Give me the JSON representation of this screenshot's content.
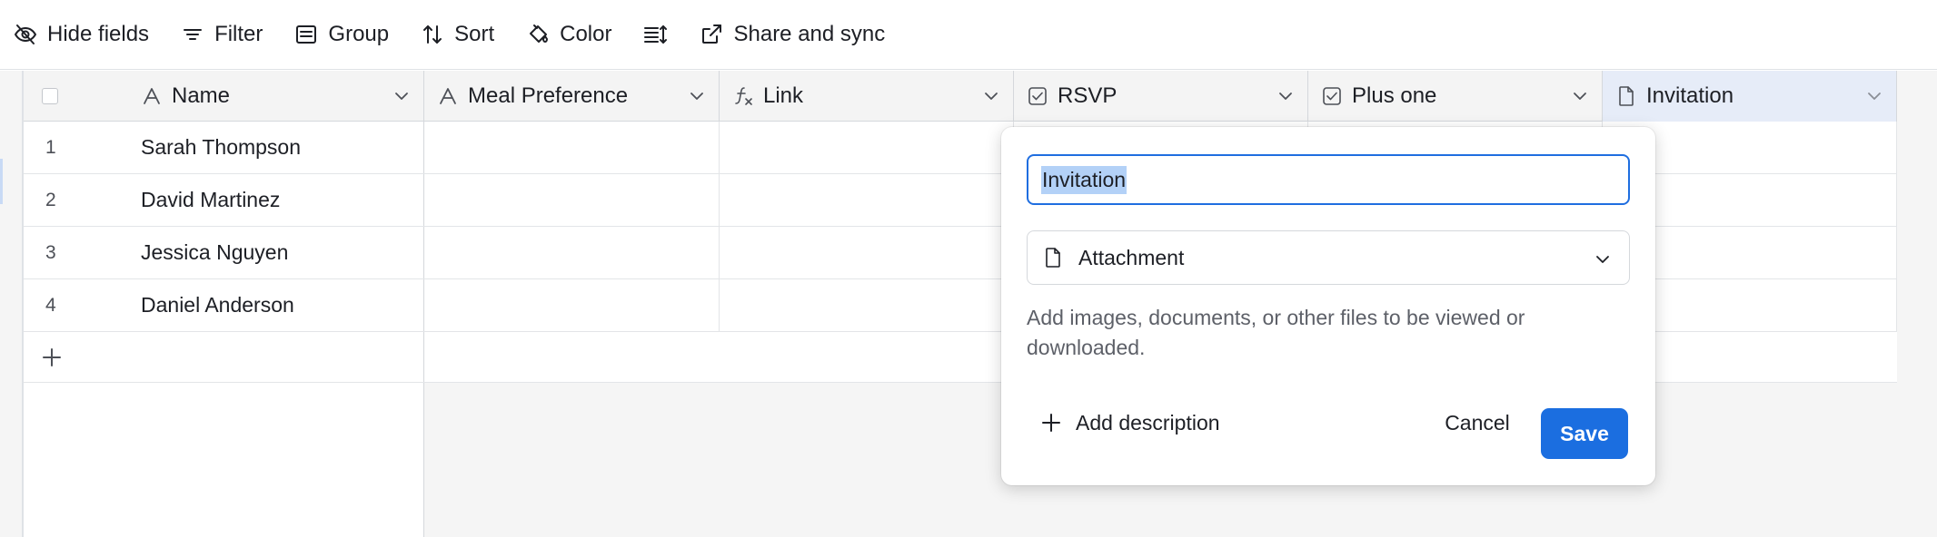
{
  "toolbar": {
    "hide_fields": "Hide fields",
    "filter": "Filter",
    "group": "Group",
    "sort": "Sort",
    "color": "Color",
    "share_sync": "Share and sync"
  },
  "columns": [
    {
      "label": "Name",
      "icon": "text-a-icon"
    },
    {
      "label": "Meal Preference",
      "icon": "text-a-icon"
    },
    {
      "label": "Link",
      "icon": "formula-icon"
    },
    {
      "label": "RSVP",
      "icon": "checkbox-icon"
    },
    {
      "label": "Plus one",
      "icon": "checkbox-icon"
    },
    {
      "label": "Invitation",
      "icon": "document-icon"
    }
  ],
  "rows": [
    {
      "num": "1",
      "name": "Sarah Thompson"
    },
    {
      "num": "2",
      "name": "David Martinez"
    },
    {
      "num": "3",
      "name": "Jessica Nguyen"
    },
    {
      "num": "4",
      "name": "Daniel Anderson"
    }
  ],
  "popup": {
    "field_name": "Invitation",
    "field_type": "Attachment",
    "help": "Add images, documents, or other files to be viewed or downloaded.",
    "add_description": "Add description",
    "cancel": "Cancel",
    "save": "Save"
  },
  "colors": {
    "accent": "#1b6ee0",
    "selection": "#b3d1f7",
    "header_selected": "#e6ecf8"
  }
}
